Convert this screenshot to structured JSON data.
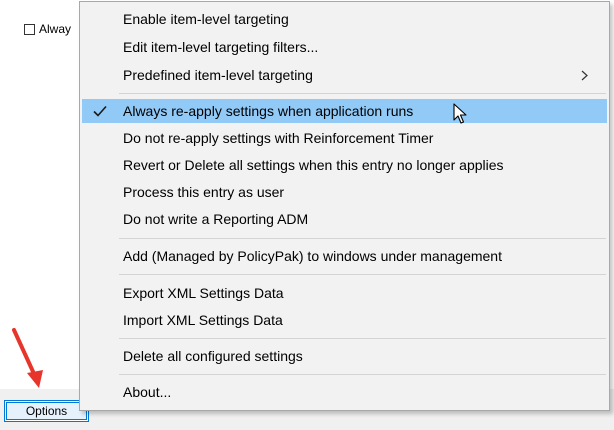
{
  "background_dialog": {
    "checkbox_label": "Alway"
  },
  "options_button": {
    "label": "Options"
  },
  "context_menu": {
    "items": [
      {
        "label": "Enable item-level targeting"
      },
      {
        "label": "Edit item-level targeting filters..."
      },
      {
        "label": "Predefined item-level targeting",
        "submenu": true
      },
      {
        "label": "Always re-apply settings when application runs",
        "checked": true,
        "highlighted": true
      },
      {
        "label": "Do not re-apply settings with Reinforcement Timer"
      },
      {
        "label": "Revert or Delete all settings when this entry no longer applies"
      },
      {
        "label": "Process this entry as user"
      },
      {
        "label": "Do not write a Reporting ADM"
      },
      {
        "label": "Add (Managed by PolicyPak) to windows under management"
      },
      {
        "label": "Export XML Settings Data"
      },
      {
        "label": "Import XML Settings Data"
      },
      {
        "label": "Delete all configured settings"
      },
      {
        "label": "About..."
      }
    ]
  },
  "colors": {
    "highlight": "#91c9f7",
    "menu_background": "#f2f2f2",
    "annotation_arrow": "#e8352b",
    "button_border": "#0078d7"
  },
  "icons": {
    "check": "check-icon",
    "submenu": "chevron-right-icon",
    "cursor": "mouse-pointer-icon",
    "annotation": "red-arrow-icon"
  }
}
